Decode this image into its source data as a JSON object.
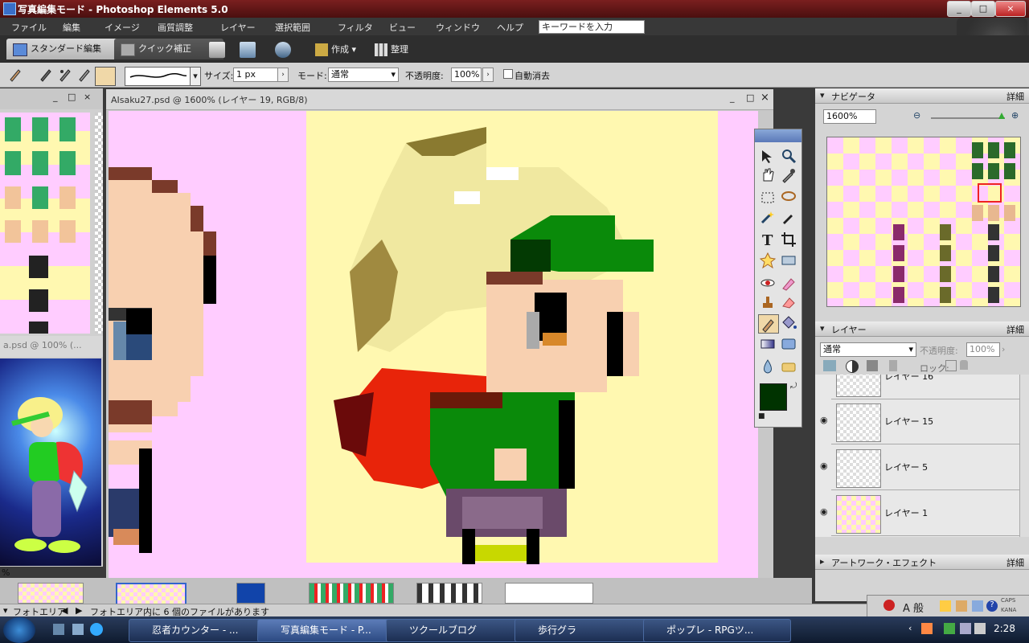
{
  "window": {
    "title": "写真編集モード - Photoshop Elements 5.0",
    "minimize": "_",
    "maximize": "□",
    "close": "×"
  },
  "menu": [
    "ファイル",
    "編集",
    "イメージ",
    "画質調整",
    "レイヤー",
    "選択範囲",
    "フィルタ",
    "ビュー",
    "ウィンドウ",
    "ヘルプ"
  ],
  "search": {
    "placeholder": "キーワードを入力"
  },
  "modes": {
    "standard": "スタンダード編集",
    "quick": "クイック補正",
    "create": "作成",
    "organize": "整理"
  },
  "options": {
    "size_label": "サイズ:",
    "size_value": "1 px",
    "mode_label": "モード:",
    "mode_value": "通常",
    "opacity_label": "不透明度:",
    "opacity_value": "100%",
    "auto_erase_label": "自動消去"
  },
  "document": {
    "title": "AIsaku27.psd @ 1600% (レイヤー 19, RGB/8)",
    "second_title": "a.psd @ 100% (..."
  },
  "navigator": {
    "title": "ナビゲータ",
    "more": "詳細",
    "zoom": "1600%"
  },
  "layers": {
    "title": "レイヤー",
    "more": "詳細",
    "blend": "通常",
    "opacity_label": "不透明度:",
    "opacity_value": "100%",
    "lock_label": "ロック:",
    "items": [
      {
        "name": "レイヤー 16"
      },
      {
        "name": "レイヤー 15"
      },
      {
        "name": "レイヤー 5"
      },
      {
        "name": "レイヤー 1"
      }
    ]
  },
  "artwork": {
    "title": "アートワーク・エフェクト",
    "more": "詳細"
  },
  "photobin": {
    "label": "フォトエリア",
    "status": "フォトエリア内に 6 個のファイルがあります"
  },
  "left_percent": "%",
  "taskbar": {
    "items": [
      "忍者カウンター - ...",
      "写真編集モード - P...",
      "ツクールブログ",
      "歩行グラ",
      "ポップレ - RPGツ..."
    ],
    "clock": "2:28"
  },
  "ime": {
    "mode": "A 般",
    "caps": "CAPS",
    "kana": "KANA"
  },
  "colors": {
    "foreground": "#003300",
    "accent": "#7a1f1f"
  }
}
